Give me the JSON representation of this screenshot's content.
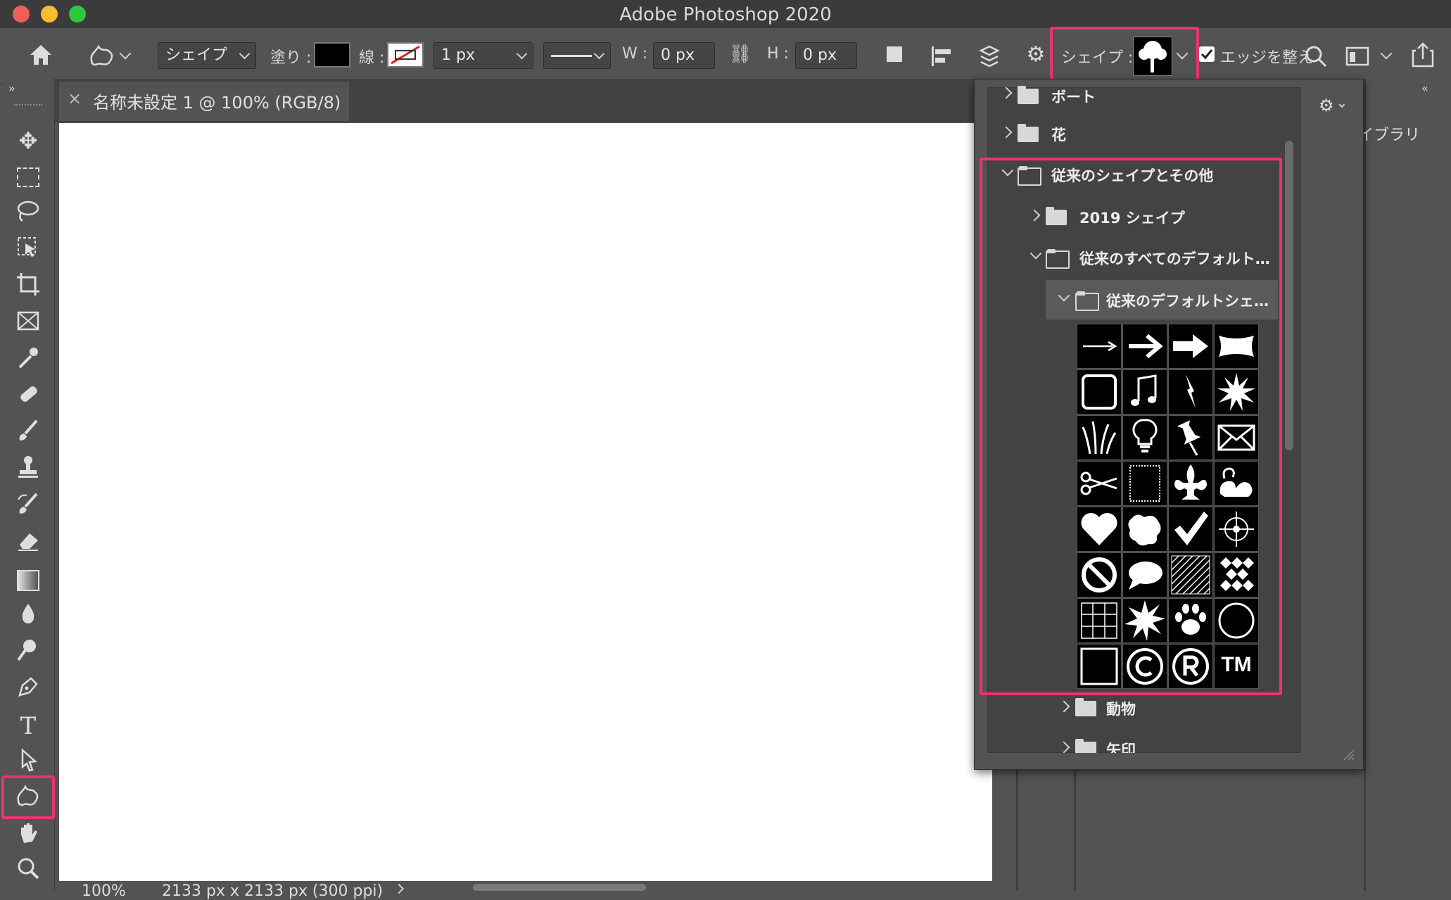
{
  "window": {
    "title": "Adobe Photoshop 2020",
    "traffic_colors": [
      "#ee5f57",
      "#f7bc2f",
      "#2ec840"
    ]
  },
  "options_bar": {
    "mode_select": "シェイプ",
    "fill_label": "塗り :",
    "stroke_label": "線 :",
    "stroke_width": "1 px",
    "w_label": "W :",
    "w_value": "0 px",
    "h_label": "H :",
    "h_value": "0 px",
    "shape_label": "シェイプ :",
    "edge_label": "エッジを整え"
  },
  "document": {
    "tab_title": "名称未設定 1 @ 100% (RGB/8)",
    "close_glyph": "×",
    "zoom": "100%",
    "doc_size": "2133 px x 2133 px (300 ppi)"
  },
  "panel": {
    "library_label": "イブラリ",
    "rows": [
      {
        "label": "ボート",
        "level": 0,
        "open": false
      },
      {
        "label": "花",
        "level": 0,
        "open": false
      },
      {
        "label": "従来のシェイプとその他",
        "level": 0,
        "open": true
      },
      {
        "label": "2019 シェイプ",
        "level": 1,
        "open": false
      },
      {
        "label": "従来のすべてのデフォルト…",
        "level": 1,
        "open": true
      },
      {
        "label": "従来のデフォルトシェ…",
        "level": 2,
        "open": true
      },
      {
        "label": "動物",
        "level": 2,
        "open": false
      },
      {
        "label": "矢印",
        "level": 2,
        "open": false
      }
    ],
    "shapes": [
      "arrow-thin-icon",
      "arrow-bold-icon",
      "arrow-block-icon",
      "banner-icon",
      "frame-icon",
      "music-note-icon",
      "lightning-icon",
      "starburst-icon",
      "grass-icon",
      "lightbulb-icon",
      "pushpin-icon",
      "envelope-icon",
      "scissors-icon",
      "stamp-frame-icon",
      "fleur-de-lis-icon",
      "ornament-icon",
      "heart-icon",
      "puzzle-icon",
      "checkmark-icon",
      "target-icon",
      "no-sign-icon",
      "speech-bubble-icon",
      "hatch-pattern-icon",
      "checker-pattern-icon",
      "grid-icon",
      "burst-icon",
      "paw-icon",
      "circle-icon",
      "square-icon",
      "copyright-icon",
      "registered-icon",
      "trademark-icon"
    ],
    "trademark_text": "TM"
  },
  "colors": {
    "highlight": "#e8356b",
    "app_bg": "#535353"
  }
}
